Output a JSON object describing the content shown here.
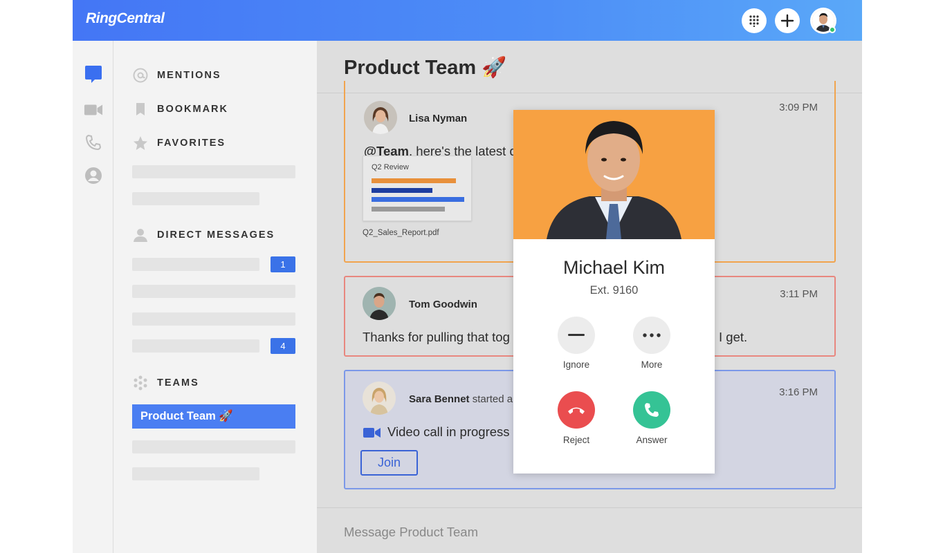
{
  "app": {
    "logo": "RingCentral"
  },
  "topbar": {
    "dialpad_icon": "dialpad-icon",
    "add_icon": "plus-icon",
    "user_status": "online"
  },
  "rail": {
    "items": [
      "chat-bubble-icon",
      "video-icon",
      "phone-icon",
      "contacts-icon"
    ]
  },
  "sidebar": {
    "mentions": "MENTIONS",
    "bookmark": "BOOKMARK",
    "favorites": "FAVORITES",
    "direct_messages": "DIRECT MESSAGES",
    "dm_badges": [
      "1",
      "4"
    ],
    "teams": "TEAMS",
    "active_team": "Product Team 🚀"
  },
  "main": {
    "title": "Product Team 🚀",
    "messages": [
      {
        "sender": "Lisa Nyman",
        "time": "3:09 PM",
        "mention": "@Team",
        "text": ", here's the latest d",
        "attachment": {
          "title": "Q2 Review",
          "file_name": "Q2_Sales_Report.pdf"
        }
      },
      {
        "sender": "Tom Goodwin",
        "time": "3:11 PM",
        "text_left": "Thanks for pulling that tog",
        "text_right": "I get."
      },
      {
        "sender": "Sara Bennet",
        "action": " started a",
        "time": "3:16 PM",
        "text": "Video call in progress",
        "button": "Join"
      }
    ],
    "composer_placeholder": "Message Product Team"
  },
  "call": {
    "name": "Michael Kim",
    "ext": "Ext. 9160",
    "ignore": "Ignore",
    "more": "More",
    "reject": "Reject",
    "answer": "Answer"
  },
  "colors": {
    "accent": "#3a72e8",
    "reject": "#ea4d4f",
    "answer": "#35c395",
    "photo_bg": "#f7a142"
  }
}
